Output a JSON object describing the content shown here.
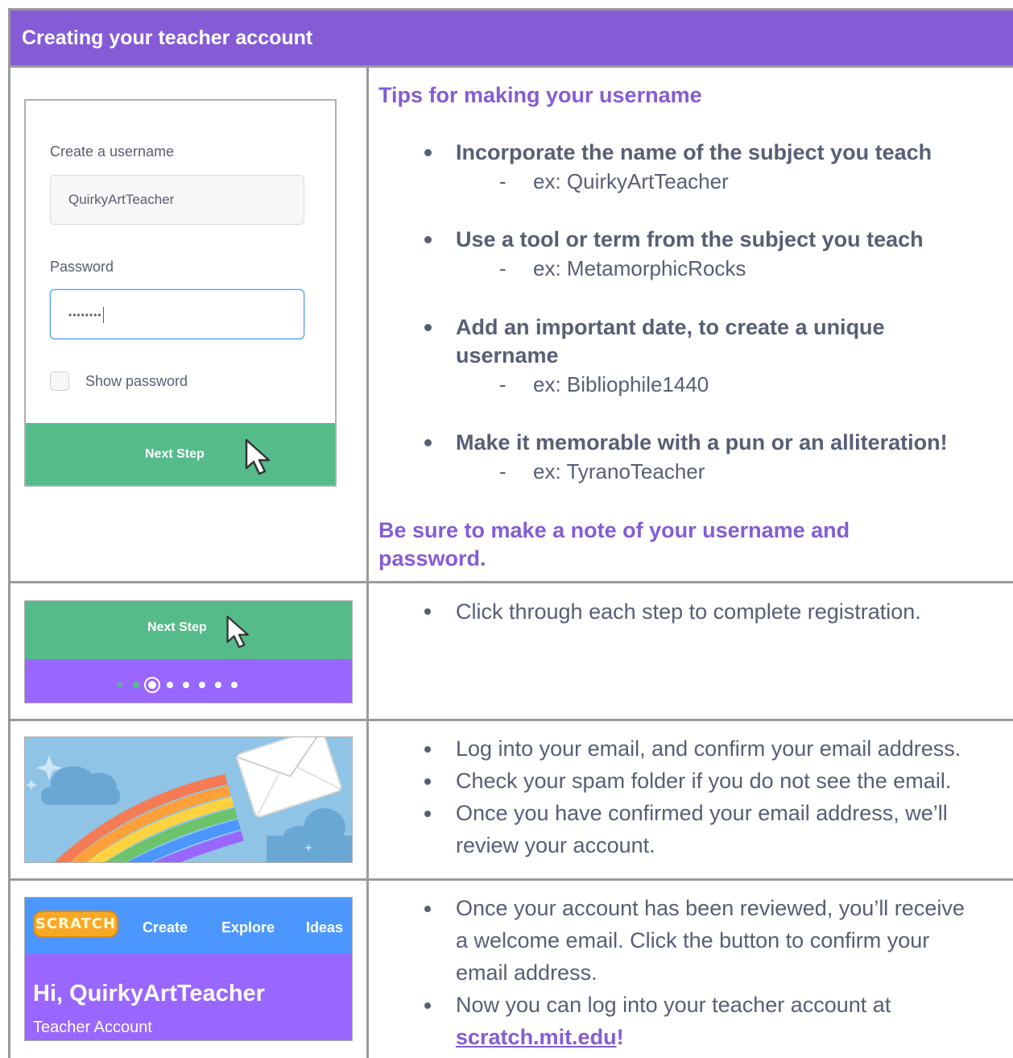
{
  "header": {
    "title": "Creating your teacher account"
  },
  "login_form": {
    "username_label": "Create a username",
    "username_value": "QuirkyArtTeacher",
    "password_label": "Password",
    "password_value": "••••••••",
    "show_password_label": "Show password",
    "next_button": "Next Step"
  },
  "tips": {
    "heading": "Tips for making your username",
    "items": [
      {
        "title": "Incorporate the name of the subject you teach",
        "example": "ex: QuirkyArtTeacher"
      },
      {
        "title_line1": "Add an important date, to create a unique",
        "title_line2": "username",
        "example": "ex: Bibliophile1440"
      },
      {
        "title": "Use a tool or term from the subject you teach",
        "example": "ex: MetamorphicRocks"
      },
      {
        "title": "Make it memorable with a pun or an alliteration!",
        "example": "ex: TyranoTeacher"
      }
    ],
    "dash": "-",
    "note_line1": "Be sure to make a note of your username and",
    "note_line2": "password."
  },
  "step_panel": {
    "next_button": "Next Step"
  },
  "row2": {
    "text": "Click through each step to complete registration."
  },
  "row3": {
    "items": [
      "Log into your email, and confirm your email address.",
      "Check your spam folder if you do not see the email.",
      "Once you have confirmed your email address, we’ll",
      "review your account."
    ]
  },
  "scratch_panel": {
    "logo": "SCRATCH",
    "nav": [
      "Create",
      "Explore",
      "Ideas"
    ],
    "greeting": "Hi, QuirkyArtTeacher",
    "account_type": "Teacher Account"
  },
  "row4": {
    "lines": [
      "Once your account has been reviewed, you’ll receive",
      "a welcome email. Click the button to confirm your",
      "email address.",
      "Now you can log into your teacher account at"
    ],
    "link": "scratch.mit.edu",
    "link_suffix": "!"
  },
  "colors": {
    "purple": "#855cd6",
    "green": "#55bb8a",
    "blue": "#4c97ff",
    "violet": "#9966ff",
    "text": "#575e75"
  }
}
